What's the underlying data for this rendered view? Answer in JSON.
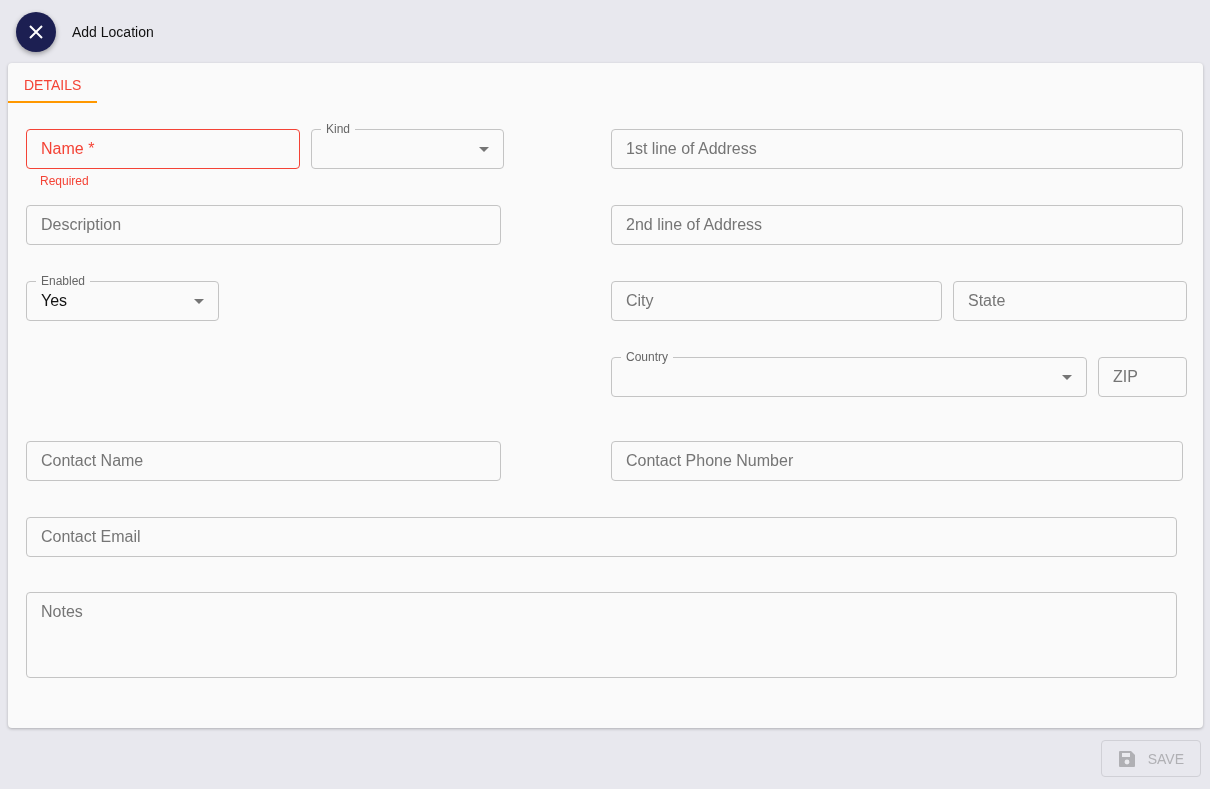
{
  "header": {
    "title": "Add Location"
  },
  "tabs": [
    {
      "label": "DETAILS",
      "selected": true
    }
  ],
  "rows": [
    {
      "left": [
        {
          "kind": "text",
          "placeholder": "Name *",
          "invalid": true,
          "helper": "Required"
        },
        {
          "kind": "select",
          "label": "Kind"
        }
      ],
      "right": [
        {
          "kind": "text",
          "placeholder": "1st line of Address",
          "invalid": false
        }
      ]
    },
    {
      "left": [
        {
          "kind": "text",
          "placeholder": "Description",
          "invalid": false
        }
      ],
      "right": [
        {
          "kind": "text",
          "placeholder": "2nd line of Address",
          "invalid": false
        }
      ]
    },
    {
      "left": [
        {
          "kind": "select",
          "label": "Enabled",
          "value": "Yes"
        }
      ],
      "right": [
        {
          "kind": "text",
          "placeholder": "City",
          "invalid": false
        },
        {
          "kind": "text",
          "placeholder": "State",
          "invalid": false
        }
      ]
    },
    {
      "left": [],
      "right": [
        {
          "kind": "select",
          "label": "Country"
        },
        {
          "kind": "text",
          "placeholder": "ZIP",
          "invalid": false
        }
      ]
    },
    {
      "left": [
        {
          "kind": "text",
          "placeholder": "Contact Name",
          "invalid": false
        }
      ],
      "right": [
        {
          "kind": "text",
          "placeholder": "Contact Phone Number",
          "invalid": false
        }
      ]
    },
    {
      "full": [
        {
          "kind": "text",
          "placeholder": "Contact Email",
          "invalid": false
        }
      ]
    },
    {
      "full": [
        {
          "kind": "textarea",
          "placeholder": "Notes",
          "invalid": false
        }
      ]
    }
  ],
  "save_button": {
    "label": "SAVE",
    "disabled": true
  }
}
